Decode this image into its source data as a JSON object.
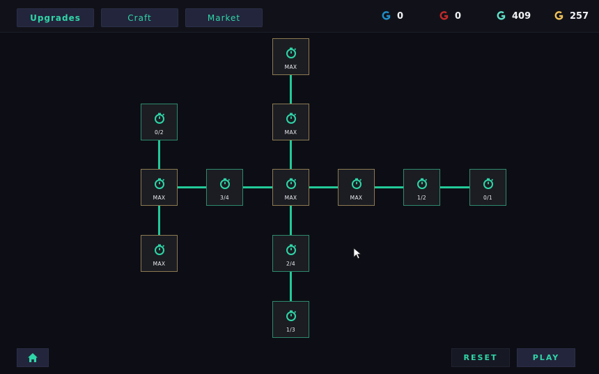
{
  "tabs": [
    {
      "label": "Upgrades"
    },
    {
      "label": "Craft"
    },
    {
      "label": "Market"
    }
  ],
  "currencies": [
    {
      "name": "blue-gem",
      "color": "#1f8fc9",
      "value": "0"
    },
    {
      "name": "red-gem",
      "color": "#c42a2a",
      "value": "0"
    },
    {
      "name": "teal-gem",
      "color": "#5fe0c8",
      "value": "409"
    },
    {
      "name": "gold-gem",
      "color": "#f3c45a",
      "value": "257"
    }
  ],
  "nodes": [
    {
      "label": "MAX",
      "icon": "stopwatch-icon",
      "maxed": true
    },
    {
      "label": "0/2",
      "icon": "stopwatch-icon",
      "maxed": false
    },
    {
      "label": "MAX",
      "icon": "stopwatch-icon",
      "maxed": true
    },
    {
      "label": "MAX",
      "icon": "stopwatch-icon",
      "maxed": true
    },
    {
      "label": "3/4",
      "icon": "stopwatch-icon",
      "maxed": false
    },
    {
      "label": "MAX",
      "icon": "stopwatch-icon",
      "maxed": true
    },
    {
      "label": "MAX",
      "icon": "stopwatch-icon",
      "maxed": true
    },
    {
      "label": "1/2",
      "icon": "stopwatch-icon",
      "maxed": false
    },
    {
      "label": "0/1",
      "icon": "stopwatch-icon",
      "maxed": false
    },
    {
      "label": "MAX",
      "icon": "stopwatch-icon",
      "maxed": true
    },
    {
      "label": "2/4",
      "icon": "stopwatch-icon",
      "maxed": false
    },
    {
      "label": "1/3",
      "icon": "stopwatch-icon",
      "maxed": false
    }
  ],
  "footer": {
    "home_icon": "home-icon",
    "reset_label": "RESET",
    "play_label": "PLAY"
  },
  "colors": {
    "accent": "#2fd6a8",
    "link": "#22c999",
    "node_border_maxed": "#8d7a52",
    "node_border": "#2f8a6d"
  }
}
